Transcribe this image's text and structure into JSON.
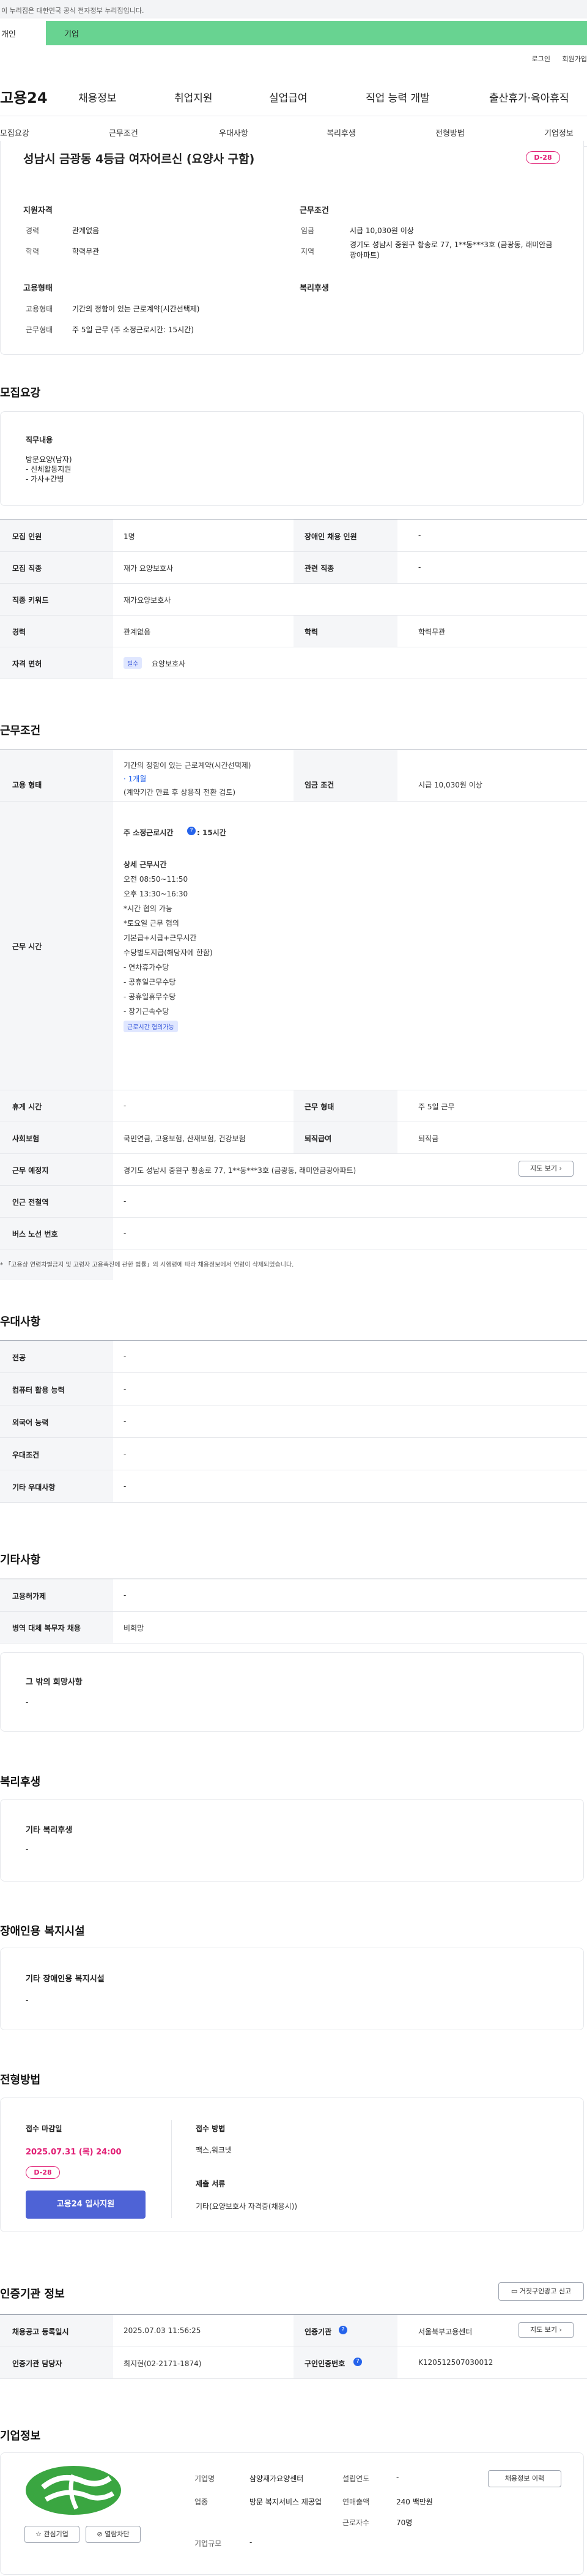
{
  "gov_banner": "이 누리집은 대한민국 공식 전자정부 누리집입니다.",
  "tabs": {
    "personal": "개인",
    "company": "기업"
  },
  "top_links": {
    "login": "로그인",
    "signup": "회원가입"
  },
  "logo": "고용24",
  "gnb": [
    "채용정보",
    "취업지원",
    "실업급여",
    "직업 능력 개발",
    "출산휴가·육아휴직"
  ],
  "snb": [
    "모집요강",
    "근무조건",
    "우대사항",
    "복리후생",
    "전형방법",
    "기업정보"
  ],
  "header": {
    "title": "성남시 금광동 4등급 여자어르신 (요양사 구함)",
    "dday": "D-28"
  },
  "summary": {
    "qual_title": "지원자격",
    "career_label": "경력",
    "career": "관계없음",
    "edu_label": "학력",
    "edu": "학력무관",
    "cond_title": "근무조건",
    "wage_label": "임금",
    "wage": "시급 10,030원 이상",
    "region_label": "지역",
    "region": "경기도 성남시 중원구 황송로 77, 1**동***3호 (금광동, 래미안금광아파트)",
    "emp_title": "고용형태",
    "emptype_label": "고용형태",
    "emptype": "기간의 정함이 있는 근로계약(시간선택제)",
    "hours_label": "근무형태",
    "hours": "주 5일 근무 (주 소정근로시간: 15시간)",
    "welfare_title": "복리후생"
  },
  "recruit": {
    "title": "모집요강",
    "duty_label": "직무내용",
    "duty_lines": [
      "방문요양(남자)",
      "- 신체활동지원",
      "- 가사+간병"
    ],
    "rows": [
      {
        "k": "모집 인원",
        "v": "1명",
        "k2": "장애인 채용 인원",
        "v2": "-"
      },
      {
        "k": "모집 직종",
        "v": "재가 요양보호사",
        "k2": "관련 직종",
        "v2": "-"
      },
      {
        "k": "직종 키워드",
        "v": "재가요양보호사"
      },
      {
        "k": "경력",
        "v": "관계없음",
        "k2": "학력",
        "v2": "학력무관"
      },
      {
        "k": "자격 면허",
        "v": "요양보호사",
        "tag": "필수"
      }
    ]
  },
  "work": {
    "title": "근무조건",
    "emp_label": "고용 형태",
    "emp_l1": "기간의 정함이 있는 근로계약(시간선택제)",
    "emp_l2": "· 1개월",
    "emp_l3": "(계약기간 만료 후 상용직 전환 검토)",
    "wage_label": "임금 조건",
    "wage": "시급 10,030원 이상",
    "time_label": "근무 시간",
    "weekly": "주 소정근로시간",
    "weekly_val": ": 15시간",
    "time_lines": [
      "상세 근무시간",
      "오전 08:50~11:50",
      "오후 13:30~16:30",
      "*시간 협의 가능",
      "*토요일 근무 협의",
      "기본급+시급+근무시간",
      "수당별도지급(해당자에 한함)",
      "- 연차휴가수당",
      "- 공휴일근무수당",
      "- 공휴일휴무수당",
      "- 장기근속수당"
    ],
    "time_badge": "근로시간 협의가능",
    "rest_label": "휴게 시간",
    "rest": "-",
    "form_label": "근무 형태",
    "form": "주 5일 근무",
    "ins_label": "사회보험",
    "ins": "국민연금, 고용보험, 산재보험, 건강보험",
    "sev_label": "퇴직급여",
    "sev": "퇴직금",
    "place_label": "근무 예정지",
    "place": "경기도 성남시 중원구 황송로 77, 1**동***3호 (금광동, 래미안금광아파트)",
    "map_btn": "지도 보기",
    "subway_label": "인근 전철역",
    "subway": "-",
    "bus_label": "버스 노선 번호",
    "bus": "-",
    "note": "「고용상 연령차별금지 및 고령자 고용촉진에 관한 법률」의 시행령에 따라 채용정보에서 연령이 삭제되었습니다."
  },
  "pref": {
    "title": "우대사항",
    "rows": [
      [
        "전공",
        "-"
      ],
      [
        "컴퓨터 활용 능력",
        "-"
      ],
      [
        "외국어 능력",
        "-"
      ],
      [
        "우대조건",
        "-"
      ],
      [
        "기타 우대사항",
        "-"
      ]
    ]
  },
  "etc": {
    "title": "기타사항",
    "rows": [
      [
        "고용허가제",
        "-"
      ],
      [
        "병역 대체 복무자 채용",
        "비희망"
      ]
    ],
    "other_title": "그 밖의 희망사항",
    "other": "-"
  },
  "welfare": {
    "title": "복리후생",
    "box_title": "기타 복리후생",
    "box_val": "-"
  },
  "disabled": {
    "title": "장애인용 복지시설",
    "box_title": "기타 장애인용 복지시설",
    "box_val": "-"
  },
  "screening": {
    "title": "전형방법",
    "deadline_label": "접수 마감일",
    "deadline": "2025.07.31 (목) 24:00",
    "dday": "D-28",
    "apply_btn": "고용24 입사지원",
    "method_label": "접수 방법",
    "method": "팩스,워크넷",
    "docs_label": "제출 서류",
    "docs": "기타(요양보호사 자격증(채용시))"
  },
  "agency": {
    "title": "인증기관 정보",
    "report_btn": "거짓구인광고 신고",
    "reg_label": "채용공고 등록일시",
    "reg": "2025.07.03 11:56:25",
    "agency_label": "인증기관",
    "agency": "서울북부고용센터",
    "map_btn": "지도 보기",
    "manager_label": "인증기관 담당자",
    "manager": "최지현(02-2171-1874)",
    "id_label": "구인인증번호",
    "id": "K120512507030012"
  },
  "company": {
    "title": "기업정보",
    "fav_btn": "관심기업",
    "blind_btn": "열람차단",
    "name_label": "기업명",
    "name": "삼양재가요양센터",
    "est_label": "설립연도",
    "est": "-",
    "biz_label": "업종",
    "biz": "방문 복지서비스 제공업",
    "sales_label": "연매출액",
    "sales": "240 백만원",
    "size_label": "기업규모",
    "size": "-",
    "emp_label": "근로자수",
    "emp": "70명",
    "jobs_btn": "채용정보 이력"
  },
  "colors": {
    "green_tab": "#68d391",
    "dday": "#e11d74",
    "apply": "#4e63d6"
  }
}
